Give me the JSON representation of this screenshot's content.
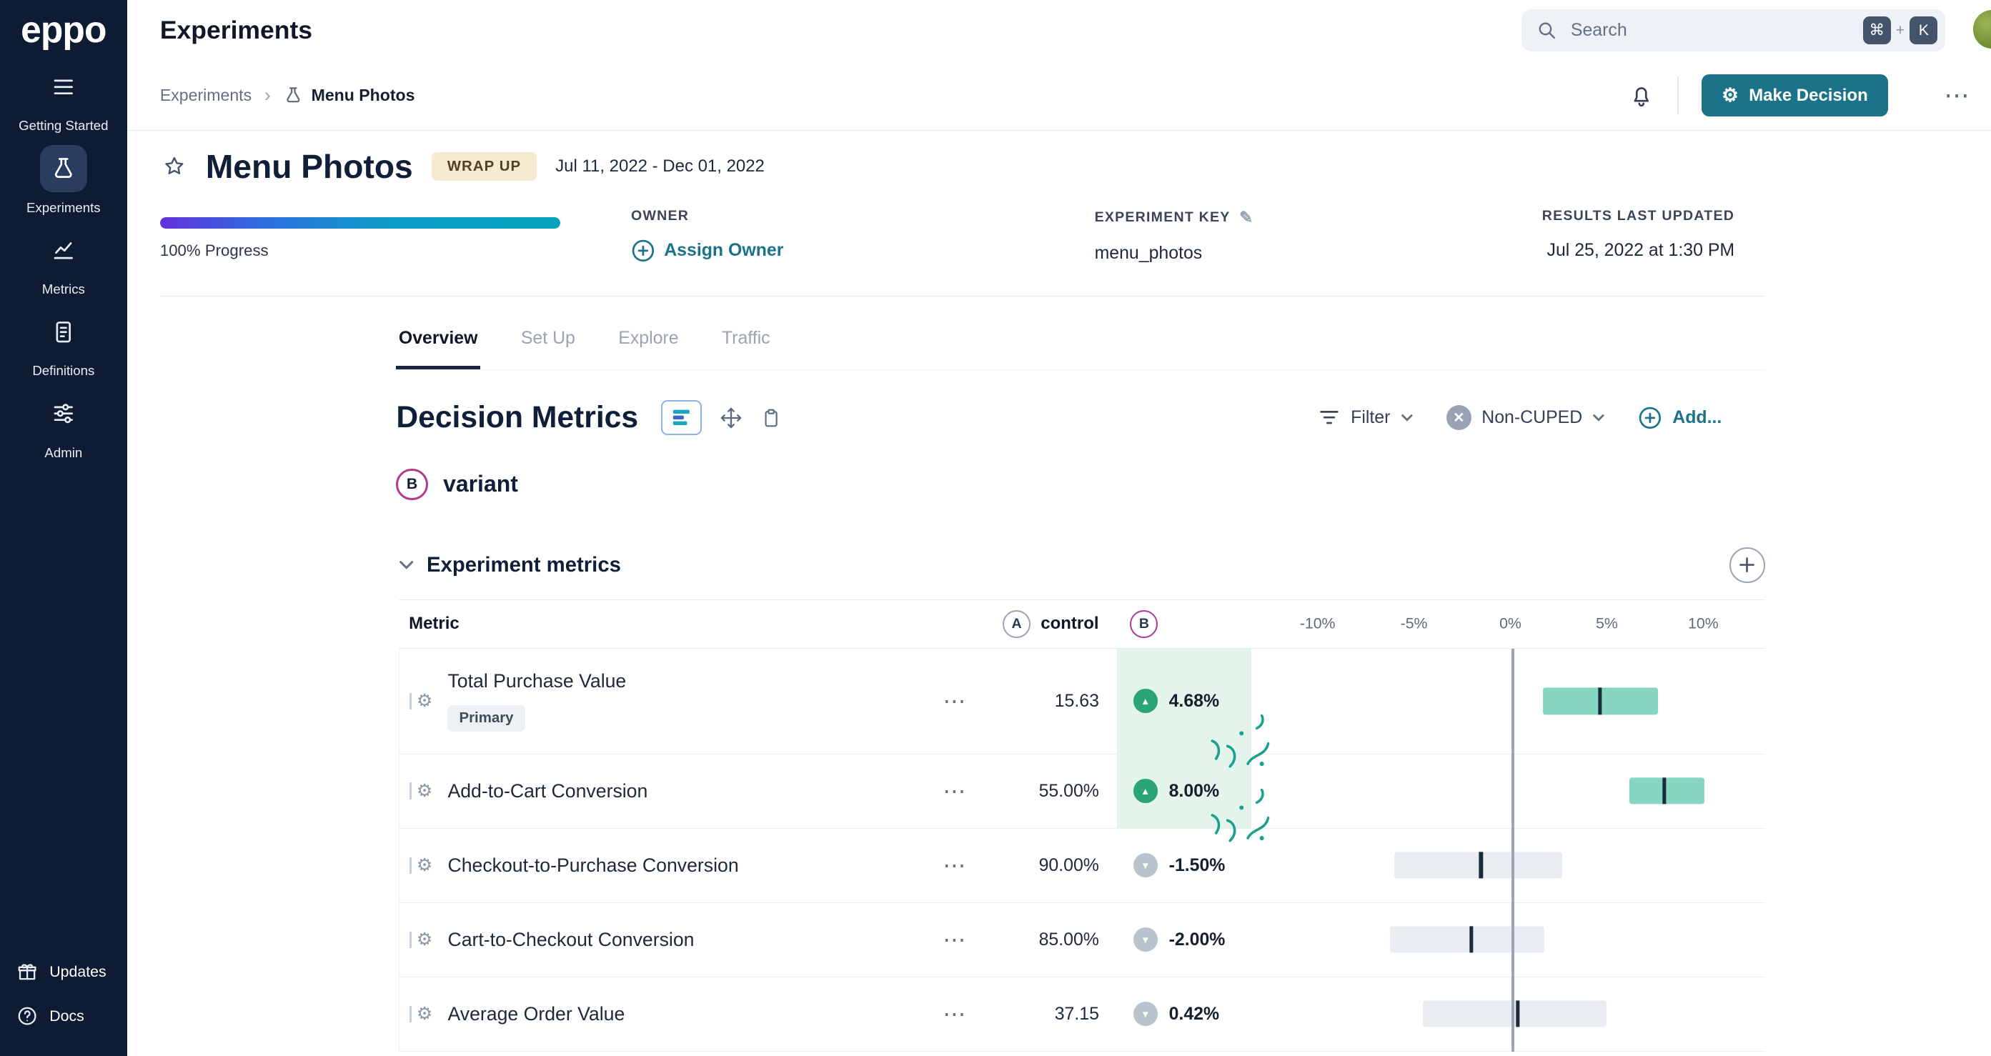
{
  "colors": {
    "sidebar": "#0d1b33",
    "teal": "#1c7389",
    "positive": "#2ba477",
    "positive_bg": "#e3f4ea",
    "bar_teal": "#87d6c1",
    "bar_gray": "#e9edf1",
    "b_ring": "#b23a8c",
    "badge_bg": "#f6ead0"
  },
  "sidebar": {
    "logo": "eppo",
    "items": [
      {
        "label": "Getting Started",
        "icon": "list"
      },
      {
        "label": "Experiments",
        "icon": "flask",
        "active": true
      },
      {
        "label": "Metrics",
        "icon": "metrics"
      },
      {
        "label": "Definitions",
        "icon": "definitions"
      },
      {
        "label": "Admin",
        "icon": "admin"
      }
    ],
    "footer_items": [
      {
        "label": "Updates",
        "icon": "gift"
      },
      {
        "label": "Docs",
        "icon": "question"
      }
    ]
  },
  "header": {
    "title": "Experiments",
    "search_placeholder": "Search",
    "shortcut_keys": [
      "⌘",
      "K"
    ],
    "shortcut_sep": "+"
  },
  "subheader": {
    "breadcrumb_root": "Experiments",
    "breadcrumb_current": "Menu Photos",
    "make_decision": "Make Decision",
    "more": "⋯"
  },
  "experiment": {
    "name": "Menu Photos",
    "status": "WRAP UP",
    "date_range": "Jul 11, 2022 - Dec 01, 2022",
    "progress_label": "100% Progress",
    "progress_percent": 100,
    "owner_label": "OWNER",
    "assign_owner": "Assign Owner",
    "key_label": "EXPERIMENT KEY",
    "key_value": "menu_photos",
    "results_label": "RESULTS LAST UPDATED",
    "results_value": "Jul 25, 2022 at 1:30 PM"
  },
  "tabs": [
    {
      "label": "Overview",
      "active": true
    },
    {
      "label": "Set Up",
      "active": false
    },
    {
      "label": "Explore",
      "active": false
    },
    {
      "label": "Traffic",
      "active": false
    }
  ],
  "metrics_section": {
    "title": "Decision Metrics",
    "filter_label": "Filter",
    "cuped_label": "Non-CUPED",
    "add_label": "Add...",
    "variant_badge": "B",
    "variant_label": "variant",
    "group_title": "Experiment metrics"
  },
  "chart_data": {
    "type": "table",
    "columns": {
      "metric": "Metric",
      "control_badge": "A",
      "control_label": "control",
      "treatment_badge": "B"
    },
    "axis": {
      "min": -13.4,
      "max": 13.2
    },
    "ticks": [
      {
        "label": "-10%",
        "value": -10
      },
      {
        "label": "-5%",
        "value": -5
      },
      {
        "label": "0%",
        "value": 0
      },
      {
        "label": "5%",
        "value": 5
      },
      {
        "label": "10%",
        "value": 10
      }
    ],
    "rows": [
      {
        "metric": "Total Purchase Value",
        "badge": "Primary",
        "control": "15.63",
        "lift": "4.68%",
        "direction": "up",
        "significant": true,
        "bar": {
          "lo": 1.7,
          "hi": 7.7,
          "marker": 4.68
        }
      },
      {
        "metric": "Add-to-Cart Conversion",
        "badge": null,
        "control": "55.00%",
        "lift": "8.00%",
        "direction": "up",
        "significant": true,
        "bar": {
          "lo": 6.2,
          "hi": 10.1,
          "marker": 8.0
        }
      },
      {
        "metric": "Checkout-to-Purchase Conversion",
        "badge": null,
        "control": "90.00%",
        "lift": "-1.50%",
        "direction": "down",
        "significant": false,
        "bar": {
          "lo": -6.0,
          "hi": 2.7,
          "marker": -1.5
        }
      },
      {
        "metric": "Cart-to-Checkout Conversion",
        "badge": null,
        "control": "85.00%",
        "lift": "-2.00%",
        "direction": "down",
        "significant": false,
        "bar": {
          "lo": -6.2,
          "hi": 1.8,
          "marker": -2.0
        }
      },
      {
        "metric": "Average Order Value",
        "badge": null,
        "control": "37.15",
        "lift": "0.42%",
        "direction": "down",
        "significant": false,
        "bar": {
          "lo": -4.5,
          "hi": 5.0,
          "marker": 0.42
        }
      }
    ]
  }
}
